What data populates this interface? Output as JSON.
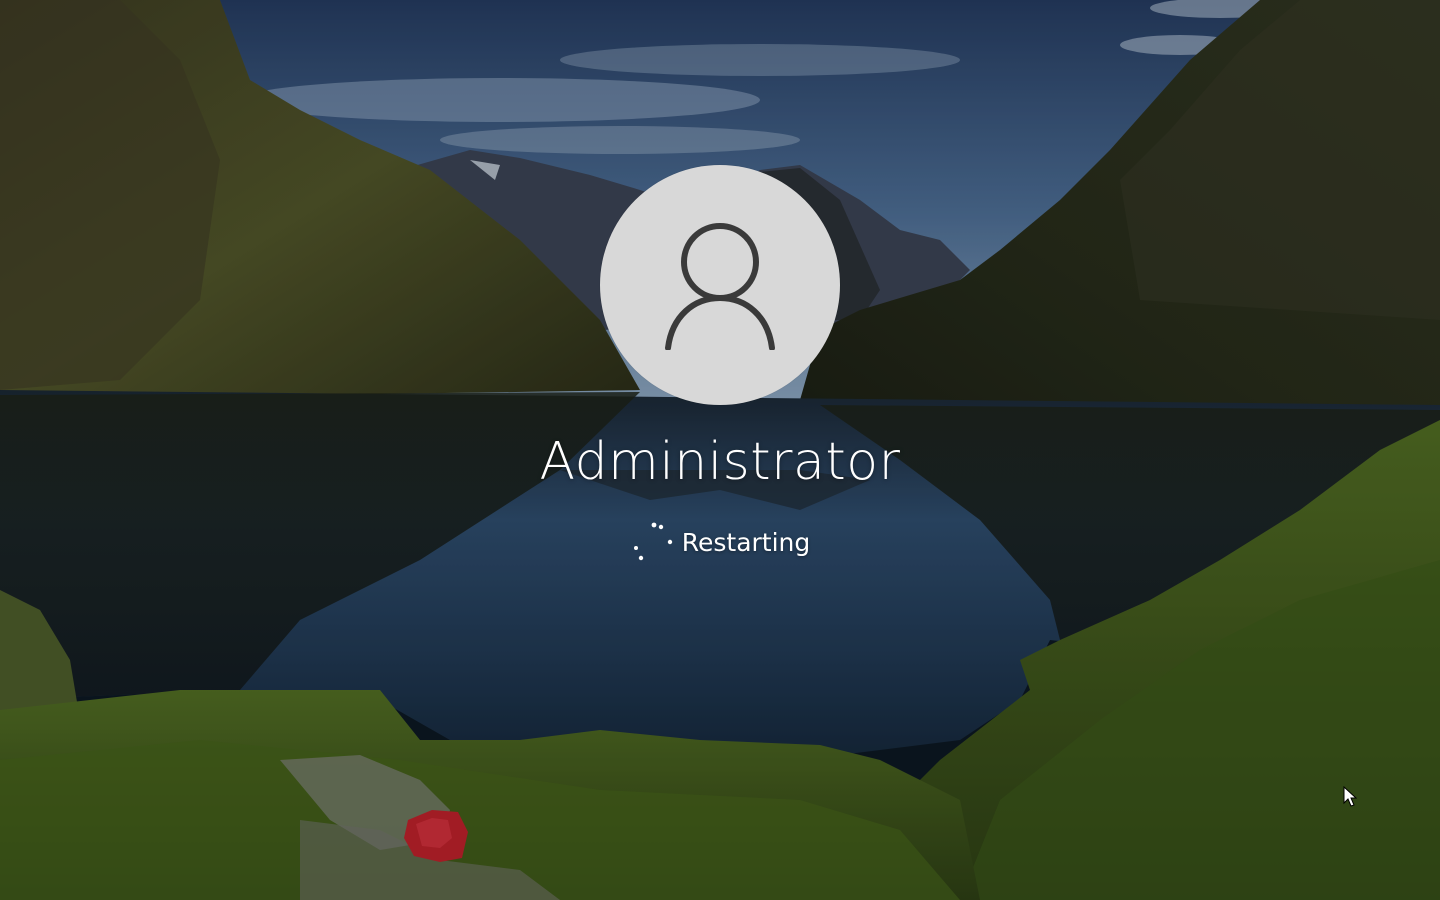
{
  "lock_screen": {
    "user": {
      "name": "Administrator",
      "avatar_icon": "user-silhouette-icon"
    },
    "status": {
      "text": "Restarting",
      "spinner_icon": "loading-dots-spinner-icon"
    }
  },
  "colors": {
    "avatar_bg": "#d8d8d8",
    "avatar_fg": "#3a3a3a",
    "text": "#ffffff"
  }
}
